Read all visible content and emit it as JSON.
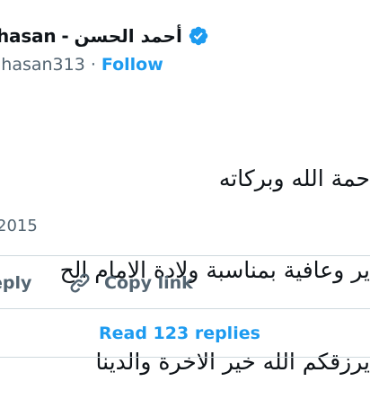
{
  "tweet": {
    "display_name": "أحمد الحسن",
    "separator": "-",
    "handle_part": "hasan",
    "username": "lhasan313",
    "dot": "·",
    "follow_label": "Follow",
    "text_lines": [
      "حمة الله وبركاته",
      "ير وعافية بمناسبة ولادة الامام الح",
      "يرزقكم الله خير الاخرة والدينا"
    ],
    "date": "2015"
  },
  "actions": {
    "reply_label": "eply",
    "copy_link_label": "Copy link",
    "read_replies_label": "Read 123 replies"
  },
  "colors": {
    "accent": "#1d9bf0",
    "muted": "#536471",
    "text": "#0f1419",
    "divider": "#cfd9de"
  },
  "icons": {
    "verified": "verified-badge-icon",
    "copy_link": "link-icon"
  }
}
